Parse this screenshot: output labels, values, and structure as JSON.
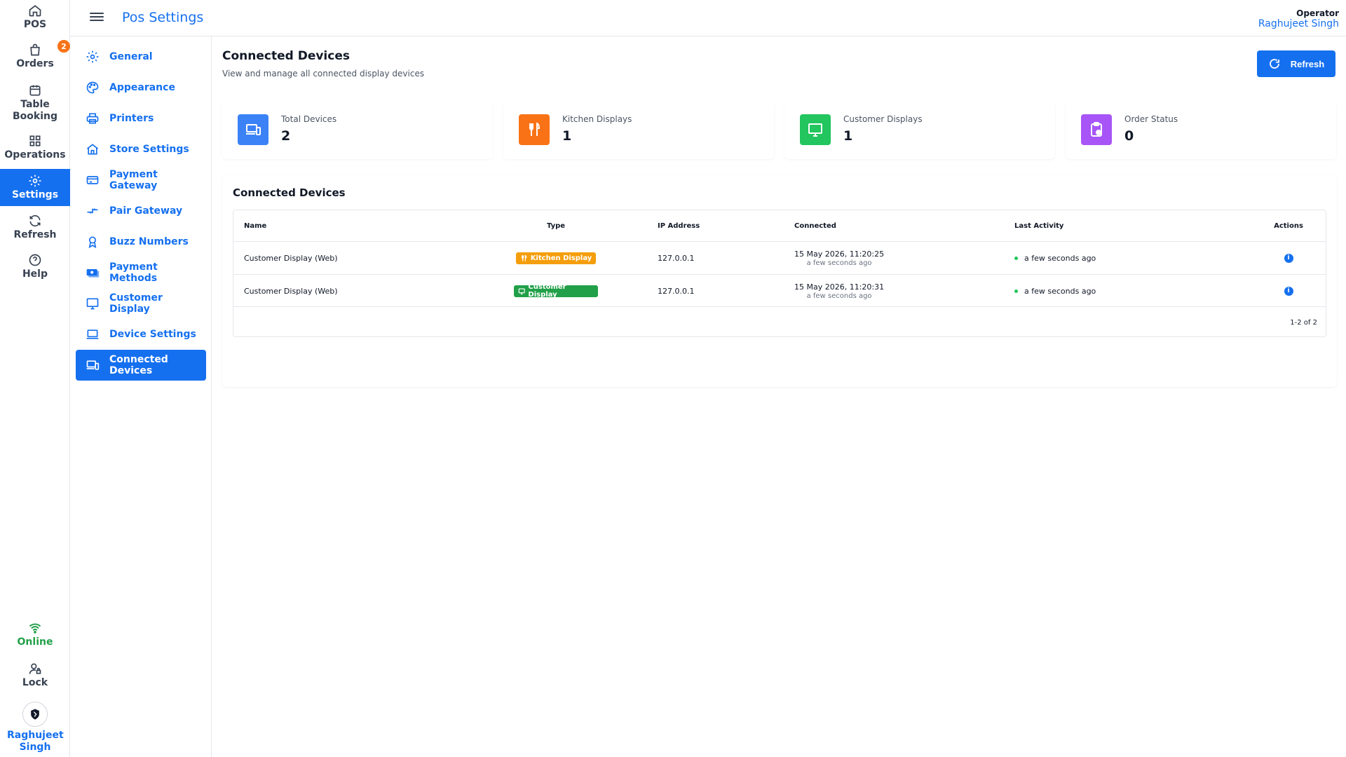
{
  "rail": {
    "items": [
      {
        "label": "POS",
        "icon": "home-icon"
      },
      {
        "label": "Orders",
        "icon": "shopping-bag-icon",
        "badge": "2"
      },
      {
        "label": "Table\nBooking",
        "icon": "calendar-icon"
      },
      {
        "label": "Operations",
        "icon": "grid-icon"
      },
      {
        "label": "Settings",
        "icon": "gear-icon",
        "active": true
      },
      {
        "label": "Refresh",
        "icon": "refresh-icon"
      },
      {
        "label": "Help",
        "icon": "help-icon"
      }
    ],
    "online_label": "Online",
    "lock_label": "Lock",
    "user_label": "Raghujeet Singh"
  },
  "header": {
    "title": "Pos Settings",
    "operator_role": "Operator",
    "operator_name": "Raghujeet Singh"
  },
  "settings_nav": {
    "items": [
      {
        "label": "General",
        "icon": "gear-icon"
      },
      {
        "label": "Appearance",
        "icon": "palette-icon"
      },
      {
        "label": "Printers",
        "icon": "printer-icon"
      },
      {
        "label": "Store Settings",
        "icon": "store-icon"
      },
      {
        "label": "Payment Gateway",
        "icon": "credit-card-icon"
      },
      {
        "label": "Pair Gateway",
        "icon": "pair-arrows-icon"
      },
      {
        "label": "Buzz Numbers",
        "icon": "badge-icon"
      },
      {
        "label": "Payment Methods",
        "icon": "money-icon"
      },
      {
        "label": "Customer Display",
        "icon": "monitor-icon"
      },
      {
        "label": "Device Settings",
        "icon": "laptop-icon"
      },
      {
        "label": "Connected Devices",
        "icon": "devices-icon",
        "active": true
      }
    ]
  },
  "main": {
    "title": "Connected Devices",
    "subtitle": "View and manage all connected display devices",
    "refresh_label": "Refresh",
    "stats": [
      {
        "label": "Total Devices",
        "value": "2",
        "color": "#3b82f6",
        "icon": "devices-icon"
      },
      {
        "label": "Kitchen Displays",
        "value": "1",
        "color": "#f97316",
        "icon": "utensils-icon"
      },
      {
        "label": "Customer Displays",
        "value": "1",
        "color": "#22c55e",
        "icon": "monitor-icon"
      },
      {
        "label": "Order Status",
        "value": "0",
        "color": "#a855f7",
        "icon": "clipboard-icon"
      }
    ],
    "table": {
      "title": "Connected Devices",
      "columns": [
        "Name",
        "Type",
        "IP Address",
        "Connected",
        "Last Activity",
        "Actions"
      ],
      "rows": [
        {
          "name": "Customer Display (Web)",
          "type": "Kitchen Display",
          "type_color": "#f59e0b",
          "type_icon": "utensils-icon",
          "ip": "127.0.0.1",
          "connected": "15 May 2026, 11:20:25",
          "connected_rel": "a few seconds ago",
          "last_activity": "a few seconds ago"
        },
        {
          "name": "Customer Display (Web)",
          "type": "Customer Display",
          "type_color": "#22a049",
          "type_icon": "monitor-icon",
          "ip": "127.0.0.1",
          "connected": "15 May 2026, 11:20:31",
          "connected_rel": "a few seconds ago",
          "last_activity": "a few seconds ago"
        }
      ],
      "pagination": "1-2 of 2"
    }
  },
  "colors": {
    "primary": "#1570ef",
    "online": "#22a049",
    "badge": "#f97316"
  }
}
